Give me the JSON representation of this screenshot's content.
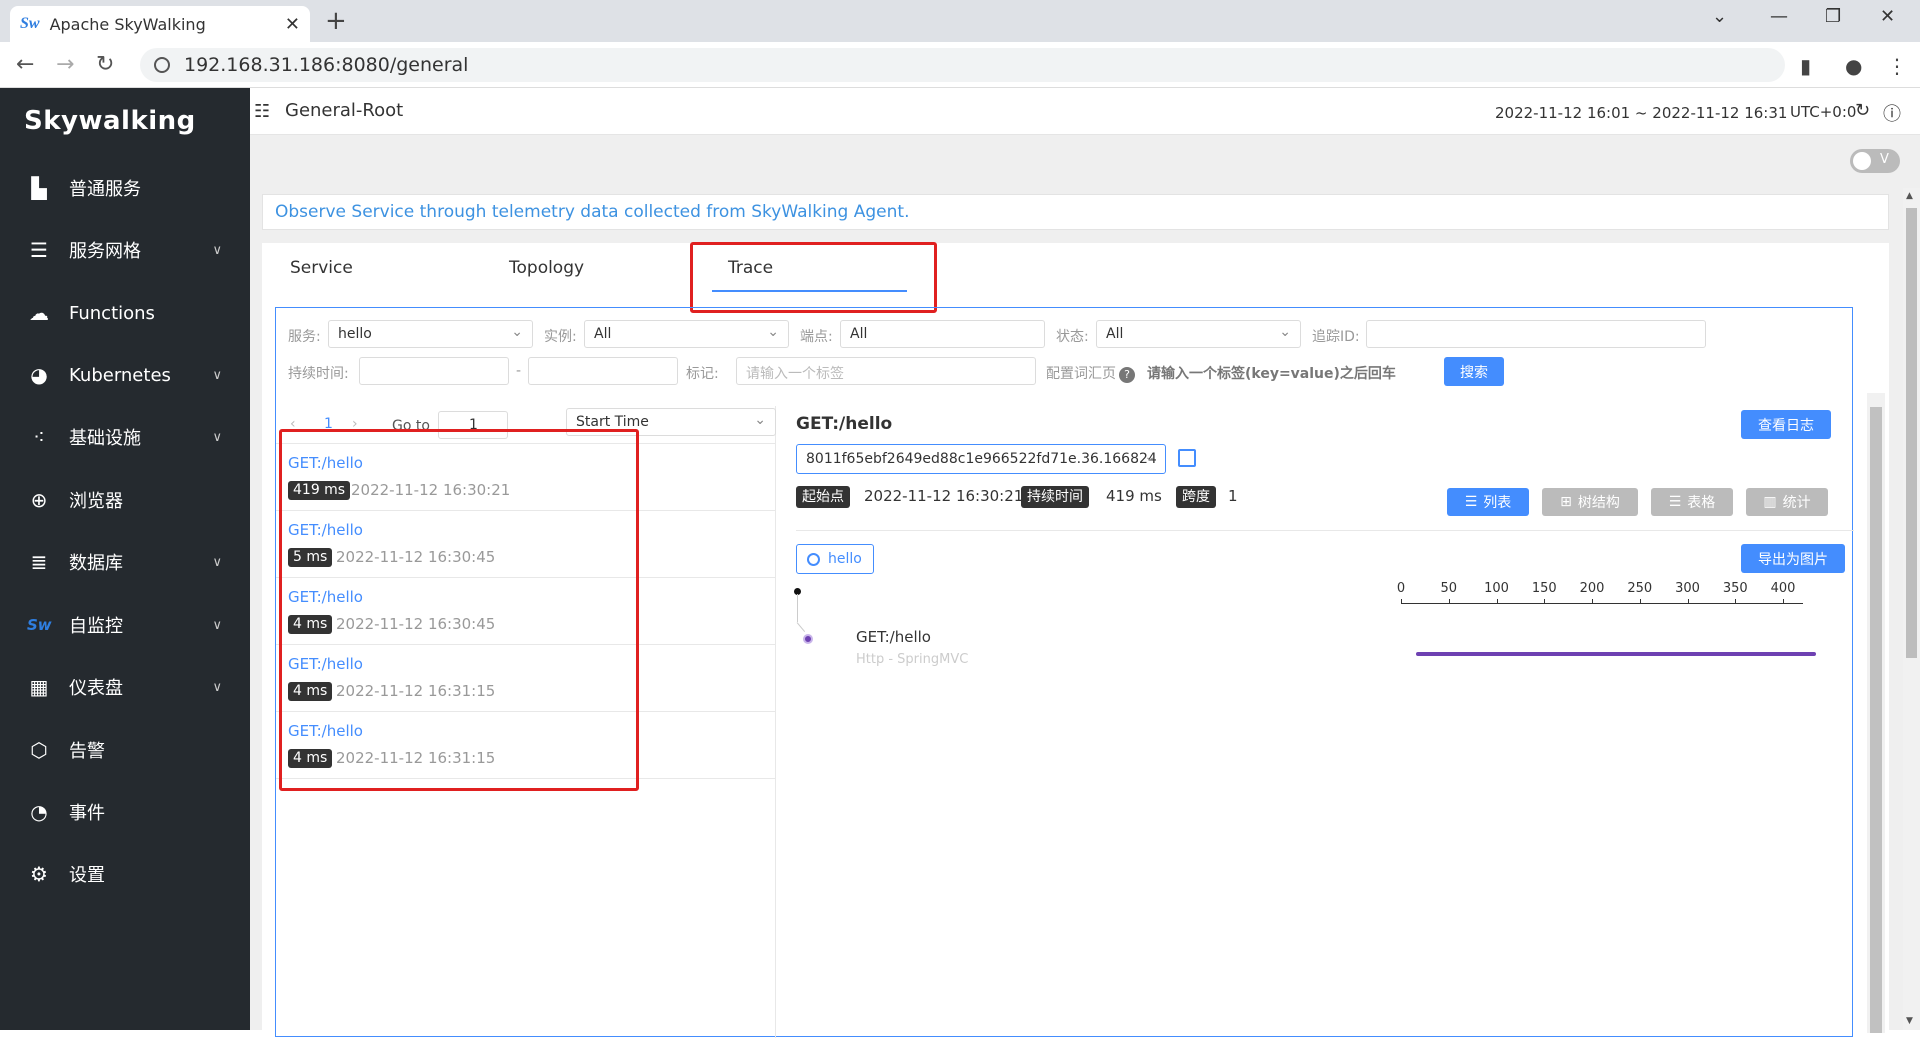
{
  "browser": {
    "tab_title": "Apache SkyWalking",
    "favicon_text": "Sw",
    "url": "192.168.31.186:8080/general"
  },
  "sidebar": {
    "logo": "Skywalking",
    "items": [
      {
        "label": "普通服务",
        "icon": "chart-icon",
        "has_children": false
      },
      {
        "label": "服务网格",
        "icon": "database-stack-icon",
        "has_children": true
      },
      {
        "label": "Functions",
        "icon": "cloud-icon",
        "has_children": false
      },
      {
        "label": "Kubernetes",
        "icon": "pie-chart-icon",
        "has_children": true
      },
      {
        "label": "基础设施",
        "icon": "nodes-icon",
        "has_children": true
      },
      {
        "label": "浏览器",
        "icon": "globe-icon",
        "has_children": false
      },
      {
        "label": "数据库",
        "icon": "list-icon",
        "has_children": true
      },
      {
        "label": "自监控",
        "icon": "sw-logo-icon",
        "has_children": true
      },
      {
        "label": "仪表盘",
        "icon": "dashboard-icon",
        "has_children": true
      },
      {
        "label": "告警",
        "icon": "alert-icon",
        "has_children": false
      },
      {
        "label": "事件",
        "icon": "clock-icon",
        "has_children": false
      },
      {
        "label": "设置",
        "icon": "gear-icon",
        "has_children": false
      }
    ]
  },
  "header": {
    "breadcrumb": "General-Root",
    "time_range": "2022-11-12 16:01 ~ 2022-11-12 16:31",
    "timezone": "UTC+0:0"
  },
  "toggle_label": "V",
  "notice": "Observe Service through telemetry data collected from SkyWalking Agent.",
  "tabs": [
    "Service",
    "Topology",
    "Trace"
  ],
  "filters": {
    "service_label": "服务:",
    "service_value": "hello",
    "instance_label": "实例:",
    "instance_value": "All",
    "endpoint_label": "端点:",
    "endpoint_value": "All",
    "status_label": "状态:",
    "status_value": "All",
    "traceid_label": "追踪ID:",
    "duration_label": "持续时间:",
    "dash": "-",
    "tag_label": "标记:",
    "tag_placeholder": "请输入一个标签",
    "config_label": "配置词汇页",
    "hint": "请输入一个标签(key=value)之后回车",
    "search_button": "搜索"
  },
  "pager": {
    "page": "1",
    "goto_label": "Go to",
    "goto_value": "1",
    "sort": "Start Time"
  },
  "traces": [
    {
      "name": "GET:/hello",
      "duration": "419 ms",
      "time": "2022-11-12 16:30:21"
    },
    {
      "name": "GET:/hello",
      "duration": "5 ms",
      "time": "2022-11-12 16:30:45"
    },
    {
      "name": "GET:/hello",
      "duration": "4 ms",
      "time": "2022-11-12 16:30:45"
    },
    {
      "name": "GET:/hello",
      "duration": "4 ms",
      "time": "2022-11-12 16:31:15"
    },
    {
      "name": "GET:/hello",
      "duration": "4 ms",
      "time": "2022-11-12 16:31:15"
    }
  ],
  "detail": {
    "title": "GET:/hello",
    "view_logs": "查看日志",
    "trace_id": "8011f65ebf2649ed88c1e966522fd71e.36.166824",
    "start_label": "起始点",
    "start_value": "2022-11-12 16:30:21",
    "duration_label": "持续时间",
    "duration_value": "419 ms",
    "span_label": "跨度",
    "span_value": "1",
    "view_list": "列表",
    "view_tree": "树结构",
    "view_table": "表格",
    "view_stats": "统计",
    "export": "导出为图片",
    "service_chip": "hello",
    "axis_ticks": [
      "0",
      "50",
      "100",
      "150",
      "200",
      "250",
      "300",
      "350",
      "400"
    ],
    "span_name": "GET:/hello",
    "span_component": "Http - SpringMVC"
  },
  "colors": {
    "accent": "#448dfe",
    "sidebar_bg": "#252a2f",
    "span_bar": "#6e41b2",
    "highlight_box": "#e02020"
  }
}
